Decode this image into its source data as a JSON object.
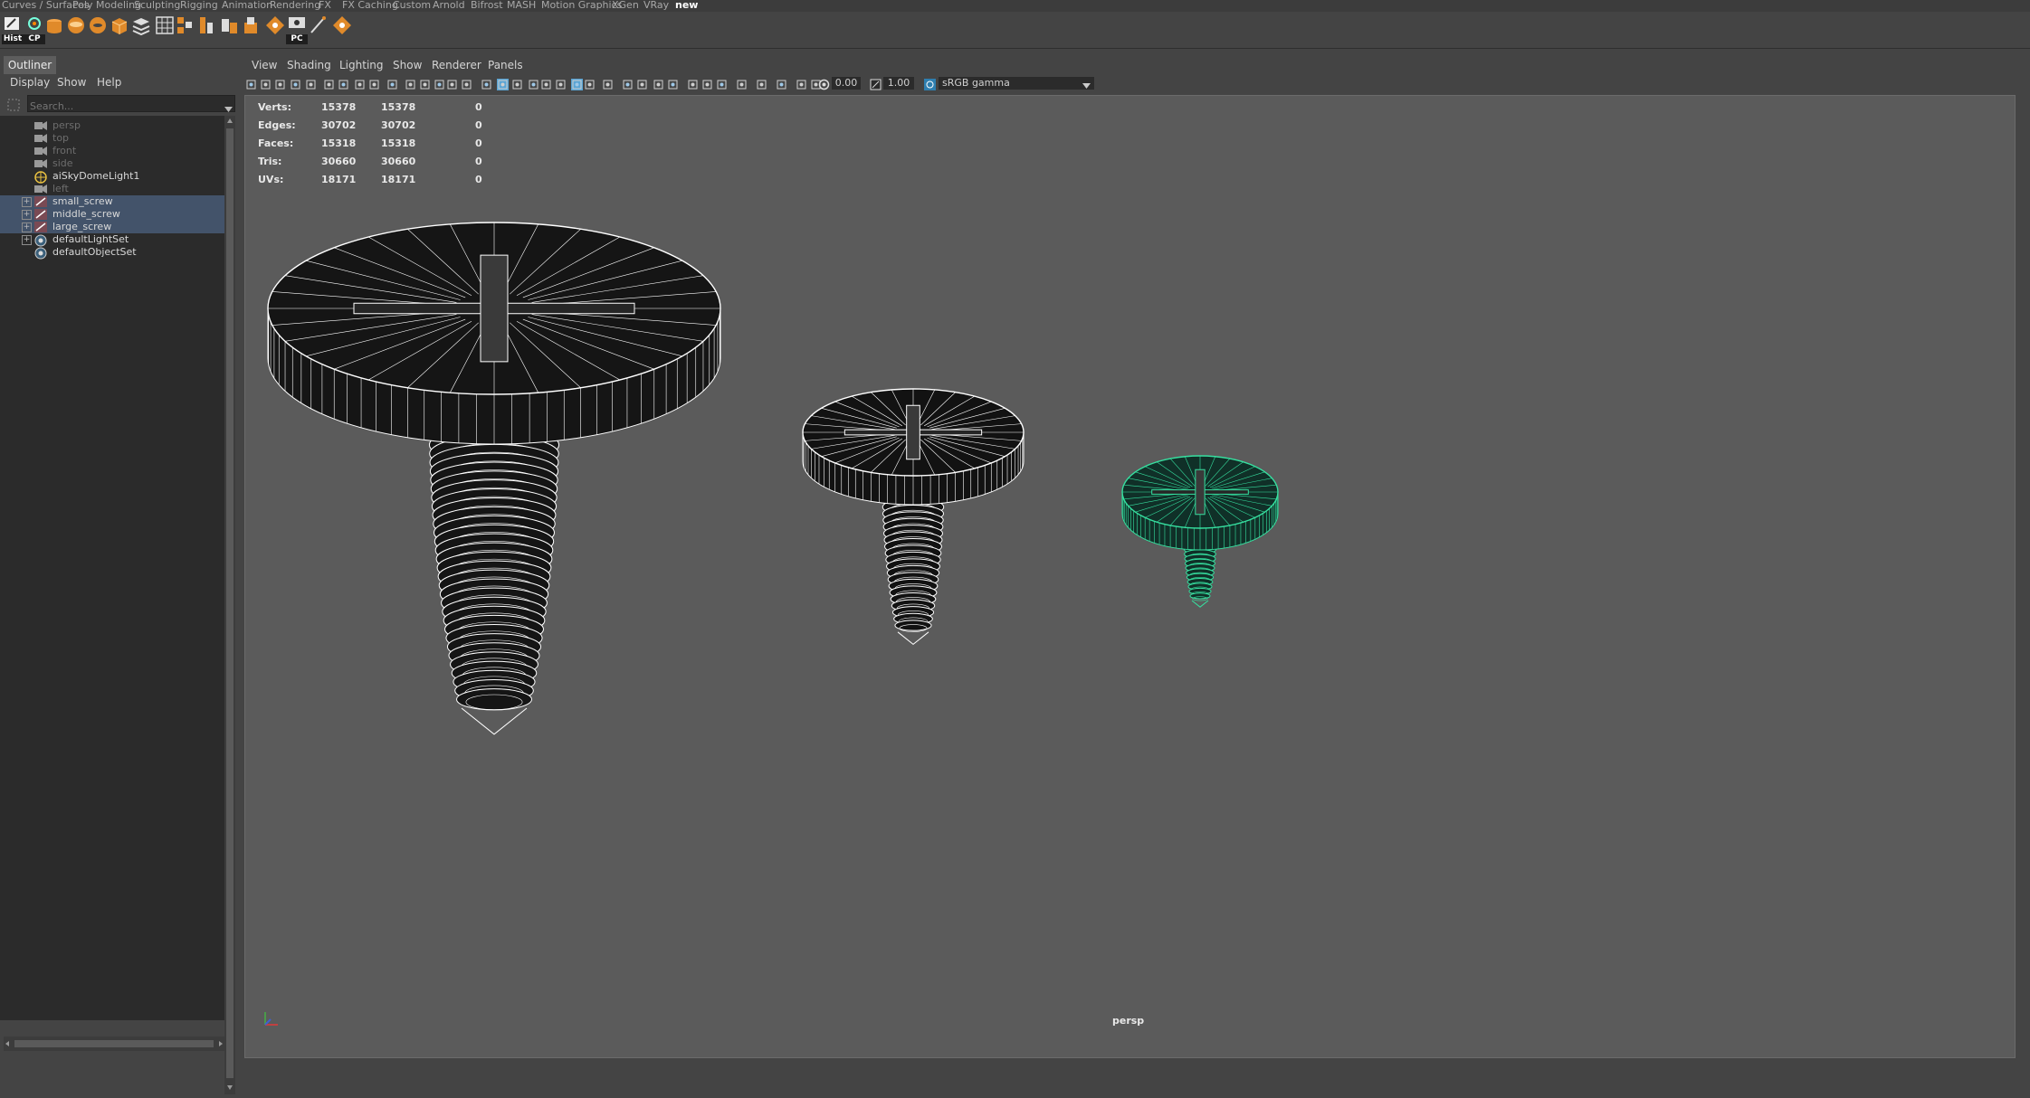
{
  "shelf": {
    "tabs": [
      "Curves / Surfaces",
      "Poly Modeling",
      "Sculpting",
      "Rigging",
      "Animation",
      "Rendering",
      "FX",
      "FX Caching",
      "Custom",
      "Arnold",
      "Bifrost",
      "MASH",
      "Motion Graphics",
      "XGen",
      "VRay",
      "new"
    ],
    "active_tab": "new",
    "icons": [
      {
        "name": "history-icon",
        "label": "Hist"
      },
      {
        "name": "center-pivot-icon",
        "label": "CP"
      },
      {
        "name": "cylinder-icon",
        "label": ""
      },
      {
        "name": "disc-icon",
        "label": ""
      },
      {
        "name": "torus-icon",
        "label": ""
      },
      {
        "name": "cube-icon",
        "label": ""
      },
      {
        "name": "stack-icon",
        "label": ""
      },
      {
        "name": "grid-icon",
        "label": ""
      },
      {
        "name": "layout-icon",
        "label": ""
      },
      {
        "name": "align-icon",
        "label": ""
      },
      {
        "name": "bevel-icon",
        "label": ""
      },
      {
        "name": "extrude-icon",
        "label": ""
      },
      {
        "name": "pivot-diamond-icon",
        "label": ""
      },
      {
        "name": "playblast-icon",
        "label": "PC"
      },
      {
        "name": "brush-icon",
        "label": ""
      },
      {
        "name": "marker-icon",
        "label": ""
      }
    ]
  },
  "outliner": {
    "title": "Outliner",
    "menu": [
      "Display",
      "Show",
      "Help"
    ],
    "search_placeholder": "Search...",
    "items": [
      {
        "label": "persp",
        "type": "camera",
        "dim": true,
        "selected": false,
        "expand": false
      },
      {
        "label": "top",
        "type": "camera",
        "dim": true,
        "selected": false,
        "expand": false
      },
      {
        "label": "front",
        "type": "camera",
        "dim": true,
        "selected": false,
        "expand": false
      },
      {
        "label": "side",
        "type": "camera",
        "dim": true,
        "selected": false,
        "expand": false
      },
      {
        "label": "aiSkyDomeLight1",
        "type": "light",
        "dim": false,
        "selected": false,
        "expand": false
      },
      {
        "label": "left",
        "type": "camera",
        "dim": true,
        "selected": false,
        "expand": false
      },
      {
        "label": "small_screw",
        "type": "mesh",
        "dim": false,
        "selected": true,
        "expand": true
      },
      {
        "label": "middle_screw",
        "type": "mesh",
        "dim": false,
        "selected": true,
        "expand": true
      },
      {
        "label": "large_screw",
        "type": "mesh",
        "dim": false,
        "selected": true,
        "expand": true
      },
      {
        "label": "defaultLightSet",
        "type": "set",
        "dim": false,
        "selected": false,
        "expand": true
      },
      {
        "label": "defaultObjectSet",
        "type": "set",
        "dim": false,
        "selected": false,
        "expand": false
      }
    ]
  },
  "viewport": {
    "menu": [
      "View",
      "Shading",
      "Lighting",
      "Show",
      "Renderer",
      "Panels"
    ],
    "exposure": "0.00",
    "gamma": "1.00",
    "color_space": "sRGB gamma",
    "camera_label": "persp",
    "hud": [
      {
        "label": "Verts:",
        "a": "15378",
        "b": "15378",
        "c": "0"
      },
      {
        "label": "Edges:",
        "a": "30702",
        "b": "30702",
        "c": "0"
      },
      {
        "label": "Faces:",
        "a": "15318",
        "b": "15318",
        "c": "0"
      },
      {
        "label": "Tris:",
        "a": "30660",
        "b": "30660",
        "c": "0"
      },
      {
        "label": "UVs:",
        "a": "18171",
        "b": "18171",
        "c": "0"
      }
    ]
  },
  "colors": {
    "selection_wire": "#36e0a0",
    "wire": "#ffffff",
    "viewport_bg": "#5b5b5b",
    "outliner_selection": "#43536a"
  }
}
